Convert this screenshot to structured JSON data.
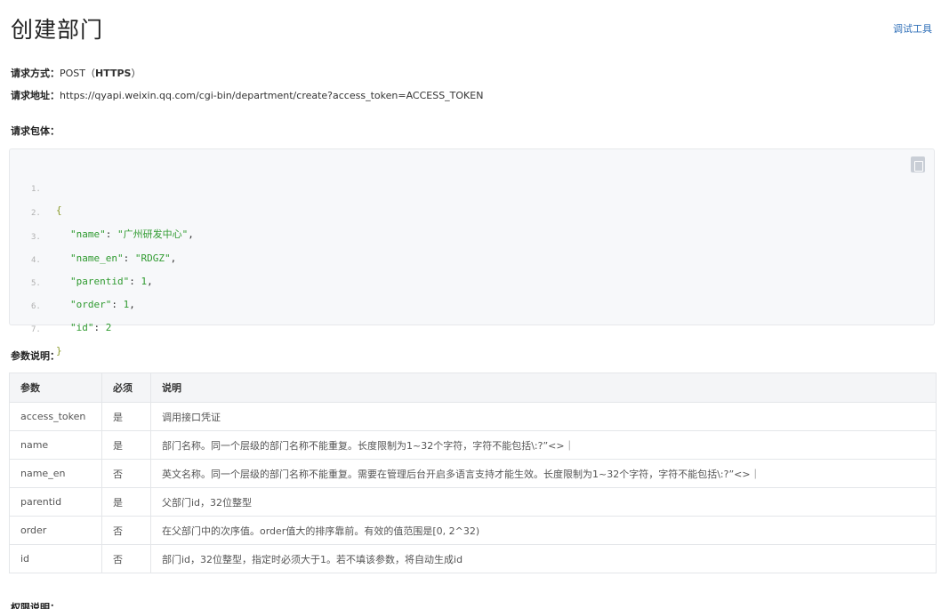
{
  "page": {
    "title": "创建部门",
    "debug_tool": "调试工具"
  },
  "request": {
    "method_label": "请求方式：",
    "method_value": "POST（",
    "method_https": "HTTPS",
    "method_close": "）",
    "url_label": "请求地址：",
    "url_value": "https://qyapi.weixin.qq.com/cgi-bin/department/create?access_token=ACCESS_TOKEN",
    "body_label": "请求包体："
  },
  "code": {
    "lines": [
      {
        "n": "1.",
        "open": "{"
      },
      {
        "n": "2.",
        "key": "\"name\"",
        "value": "\"广州研发中心\"",
        "trail": ","
      },
      {
        "n": "3.",
        "key": "\"name_en\"",
        "value": "\"RDGZ\"",
        "trail": ","
      },
      {
        "n": "4.",
        "key": "\"parentid\"",
        "value": "1",
        "trail": ","
      },
      {
        "n": "5.",
        "key": "\"order\"",
        "value": "1",
        "trail": ","
      },
      {
        "n": "6.",
        "key": "\"id\"",
        "value": "2",
        "trail": ""
      },
      {
        "n": "7.",
        "open": "}"
      }
    ]
  },
  "params": {
    "section_label": "参数说明：",
    "headers": [
      "参数",
      "必须",
      "说明"
    ],
    "rows": [
      [
        "access_token",
        "是",
        "调用接口凭证"
      ],
      [
        "name",
        "是",
        "部门名称。同一个层级的部门名称不能重复。长度限制为1~32个字符，字符不能包括\\:?”<>｜"
      ],
      [
        "name_en",
        "否",
        "英文名称。同一个层级的部门名称不能重复。需要在管理后台开启多语言支持才能生效。长度限制为1~32个字符，字符不能包括\\:?”<>｜"
      ],
      [
        "parentid",
        "是",
        "父部门id，32位整型"
      ],
      [
        "order",
        "否",
        "在父部门中的次序值。order值大的排序靠前。有效的值范围是[0, 2^32)"
      ],
      [
        "id",
        "否",
        "部门id，32位整型，指定时必须大于1。若不填该参数，将自动生成id"
      ]
    ]
  },
  "permission": {
    "section_label": "权限说明："
  }
}
